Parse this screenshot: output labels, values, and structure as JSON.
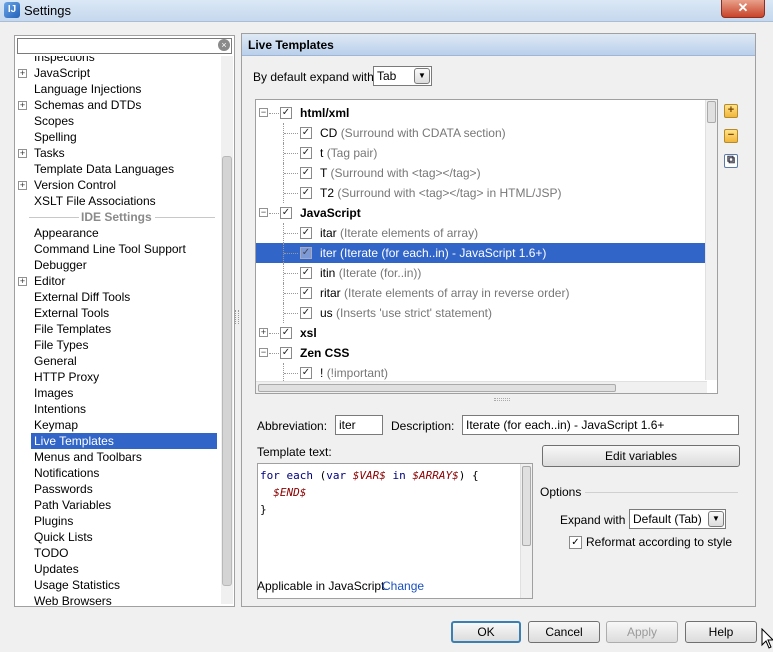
{
  "window": {
    "title": "Settings",
    "close_glyph": "✕",
    "app_icon": "intellij-icon"
  },
  "left": {
    "search_value": "",
    "clear_glyph": "×",
    "items": [
      {
        "label": "Inspections",
        "expandable": false
      },
      {
        "label": "JavaScript",
        "expandable": true
      },
      {
        "label": "Language Injections",
        "expandable": false
      },
      {
        "label": "Schemas and DTDs",
        "expandable": true
      },
      {
        "label": "Scopes",
        "expandable": false
      },
      {
        "label": "Spelling",
        "expandable": false
      },
      {
        "label": "Tasks",
        "expandable": true
      },
      {
        "label": "Template Data Languages",
        "expandable": false
      },
      {
        "label": "Version Control",
        "expandable": true
      },
      {
        "label": "XSLT File Associations",
        "expandable": false
      }
    ],
    "ide_header": "IDE Settings",
    "ide_items": [
      {
        "label": "Appearance",
        "expandable": false
      },
      {
        "label": "Command Line Tool Support",
        "expandable": false
      },
      {
        "label": "Debugger",
        "expandable": false
      },
      {
        "label": "Editor",
        "expandable": true
      },
      {
        "label": "External Diff Tools",
        "expandable": false
      },
      {
        "label": "External Tools",
        "expandable": false
      },
      {
        "label": "File Templates",
        "expandable": false
      },
      {
        "label": "File Types",
        "expandable": false
      },
      {
        "label": "General",
        "expandable": false
      },
      {
        "label": "HTTP Proxy",
        "expandable": false
      },
      {
        "label": "Images",
        "expandable": false
      },
      {
        "label": "Intentions",
        "expandable": false
      },
      {
        "label": "Keymap",
        "expandable": false
      },
      {
        "label": "Live Templates",
        "expandable": false,
        "selected": true
      },
      {
        "label": "Menus and Toolbars",
        "expandable": false
      },
      {
        "label": "Notifications",
        "expandable": false
      },
      {
        "label": "Passwords",
        "expandable": false
      },
      {
        "label": "Path Variables",
        "expandable": false
      },
      {
        "label": "Plugins",
        "expandable": false
      },
      {
        "label": "Quick Lists",
        "expandable": false
      },
      {
        "label": "TODO",
        "expandable": false
      },
      {
        "label": "Updates",
        "expandable": false
      },
      {
        "label": "Usage Statistics",
        "expandable": false
      },
      {
        "label": "Web Browsers",
        "expandable": false
      }
    ]
  },
  "main": {
    "title": "Live Templates",
    "expand_label": "By default expand with",
    "expand_value": "Tab",
    "templates": [
      {
        "kind": "group",
        "name": "html/xml",
        "checked": true,
        "expanded": true
      },
      {
        "kind": "item",
        "abbr": "CD",
        "desc": "(Surround with CDATA section)",
        "checked": true
      },
      {
        "kind": "item",
        "abbr": "t",
        "desc": "(Tag pair)",
        "checked": true
      },
      {
        "kind": "item",
        "abbr": "T",
        "desc": "(Surround with <tag></tag>)",
        "checked": true
      },
      {
        "kind": "item",
        "abbr": "T2",
        "desc": "(Surround with <tag></tag> in HTML/JSP)",
        "checked": true
      },
      {
        "kind": "group",
        "name": "JavaScript",
        "checked": true,
        "expanded": true
      },
      {
        "kind": "item",
        "abbr": "itar",
        "desc": "(Iterate elements of array)",
        "checked": true
      },
      {
        "kind": "item",
        "abbr": "iter",
        "desc": "(Iterate (for each..in) - JavaScript 1.6+)",
        "checked": true,
        "selected": true
      },
      {
        "kind": "item",
        "abbr": "itin",
        "desc": "(Iterate (for..in))",
        "checked": true
      },
      {
        "kind": "item",
        "abbr": "ritar",
        "desc": "(Iterate elements of array in reverse order)",
        "checked": true
      },
      {
        "kind": "item",
        "abbr": "us",
        "desc": "(Inserts 'use strict' statement)",
        "checked": true
      },
      {
        "kind": "group",
        "name": "xsl",
        "checked": true,
        "expanded": false
      },
      {
        "kind": "group",
        "name": "Zen CSS",
        "checked": true,
        "expanded": true
      },
      {
        "kind": "item",
        "abbr": "!",
        "desc": "(!important)",
        "checked": true
      }
    ],
    "tools": {
      "add": "+",
      "remove": "−",
      "copy": "copy-icon"
    },
    "abbreviation_label": "Abbreviation:",
    "abbreviation_value": "iter",
    "description_label": "Description:",
    "description_value": "Iterate (for each..in) - JavaScript 1.6+",
    "template_text_label": "Template text:",
    "code": {
      "line1_kw1": "for each",
      "line1_p1": " (",
      "line1_kw2": "var",
      "line1_sp": " ",
      "line1_v1": "$VAR$",
      "line1_sp2": " ",
      "line1_kw3": "in",
      "line1_sp3": " ",
      "line1_v2": "$ARRAY$",
      "line1_p2": ") {",
      "line2_indent": "  ",
      "line2_v": "$END$",
      "line3": "}"
    },
    "edit_variables": "Edit variables",
    "options_label": "Options",
    "expand_with_label": "Expand with",
    "expand_with_value": "Default (Tab)",
    "reformat_label": "Reformat according to style",
    "reformat_checked": true,
    "applicable_text": "Applicable in JavaScript.",
    "change_link": "Change"
  },
  "buttons": {
    "ok": "OK",
    "cancel": "Cancel",
    "apply": "Apply",
    "help": "Help"
  },
  "colors": {
    "selection": "#3165c8",
    "header_bg": "#c6d8ee",
    "link": "#1a4fc4"
  }
}
